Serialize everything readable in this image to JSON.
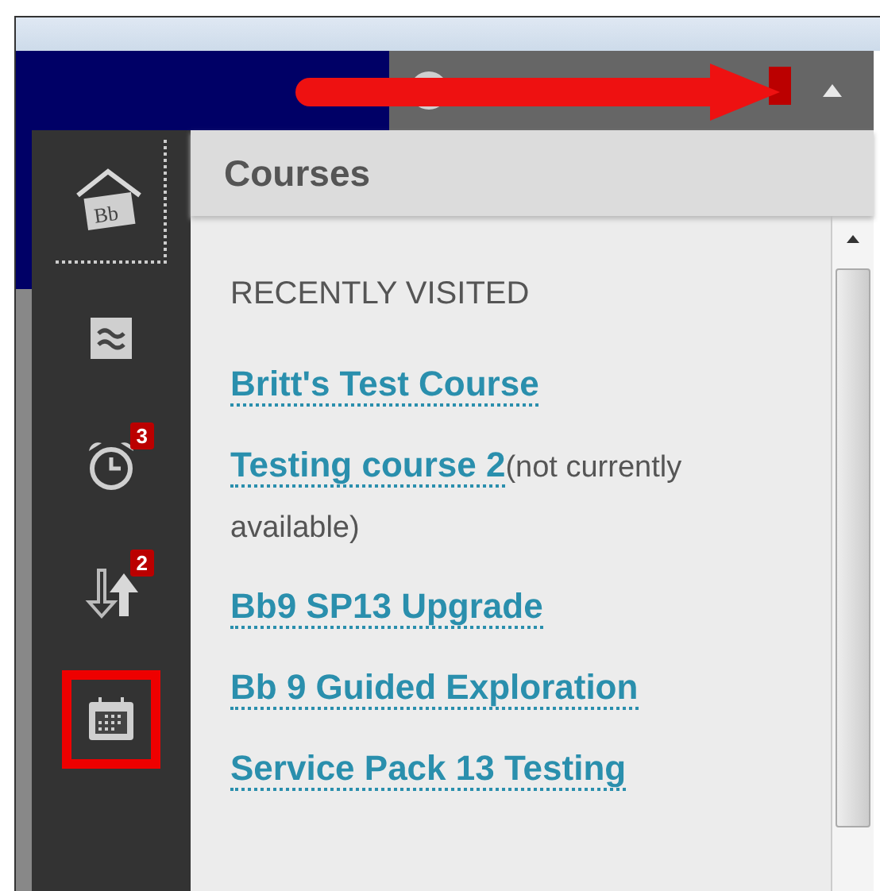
{
  "sidebar": {
    "items": [
      {
        "kind": "home",
        "selected": true,
        "annotated": false,
        "logo": "Bb"
      },
      {
        "kind": "stream",
        "selected": false,
        "annotated": false
      },
      {
        "kind": "due",
        "selected": false,
        "annotated": false,
        "badge": "3"
      },
      {
        "kind": "grades",
        "selected": false,
        "annotated": false,
        "badge": "2"
      },
      {
        "kind": "calendar",
        "selected": false,
        "annotated": true
      }
    ]
  },
  "panel": {
    "title": "Courses",
    "section": "RECENTLY VISITED",
    "courses": [
      {
        "name": "Britt's Test Course"
      },
      {
        "name": "Testing course 2",
        "note": "(not currently available)"
      },
      {
        "name": "Bb9 SP13 Upgrade"
      },
      {
        "name": "Bb 9 Guided Exploration"
      },
      {
        "name": "Service Pack 13 Testing"
      }
    ]
  }
}
